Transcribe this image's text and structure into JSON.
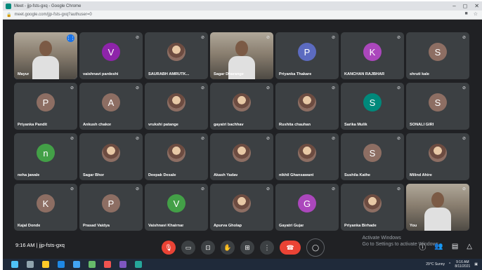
{
  "window": {
    "title": "Meet - jjp-fsts-gxq - Google Chrome",
    "url": "meet.google.com/jjp-fsts-gxq?authuser=0",
    "controls": [
      "–",
      "◻",
      "✕"
    ]
  },
  "participants": [
    {
      "name": "Mayur",
      "kind": "video",
      "speaking": true
    },
    {
      "name": "vaishnavi pardeshi",
      "kind": "initial",
      "initial": "V",
      "color": "#8e24aa"
    },
    {
      "name": "SAURABH AMRUTK...",
      "kind": "photo"
    },
    {
      "name": "Sagar Dharange",
      "kind": "video"
    },
    {
      "name": "Priyanka Thakare",
      "kind": "initial",
      "initial": "P",
      "color": "#5c6bc0"
    },
    {
      "name": "KANCHAN RAJBHAR",
      "kind": "initial",
      "initial": "K",
      "color": "#ab47bc"
    },
    {
      "name": "shruti kale",
      "kind": "initial",
      "initial": "S",
      "color": "#8d6e63"
    },
    {
      "name": "Priyanka Pandit",
      "kind": "initial",
      "initial": "P",
      "color": "#8d6e63"
    },
    {
      "name": "Ankush chakor",
      "kind": "initial",
      "initial": "A",
      "color": "#8d6e63"
    },
    {
      "name": "vrukshi patange",
      "kind": "photo"
    },
    {
      "name": "gayatri bachhav",
      "kind": "photo"
    },
    {
      "name": "Rushita chauhan",
      "kind": "photo"
    },
    {
      "name": "Sarika Mulik",
      "kind": "initial",
      "initial": "S",
      "color": "#00897b"
    },
    {
      "name": "SONALI GIRI",
      "kind": "initial",
      "initial": "S",
      "color": "#8d6e63"
    },
    {
      "name": "neha jawale",
      "kind": "initial",
      "initial": "n",
      "color": "#43a047"
    },
    {
      "name": "Sagar Bhor",
      "kind": "photo"
    },
    {
      "name": "Deepak Desale",
      "kind": "photo"
    },
    {
      "name": "Akash Yadav",
      "kind": "photo"
    },
    {
      "name": "nikhil Ghansawant",
      "kind": "photo"
    },
    {
      "name": "Sushila Kathe",
      "kind": "initial",
      "initial": "S",
      "color": "#8d6e63"
    },
    {
      "name": "Milind Ahire",
      "kind": "photo"
    },
    {
      "name": "Kajal Donde",
      "kind": "initial",
      "initial": "K",
      "color": "#8d6e63"
    },
    {
      "name": "Prasad Vaidya",
      "kind": "initial",
      "initial": "P",
      "color": "#8d6e63"
    },
    {
      "name": "Vaishnavi Khairnar",
      "kind": "initial",
      "initial": "V",
      "color": "#43a047"
    },
    {
      "name": "Apurva Gholap",
      "kind": "photo"
    },
    {
      "name": "Gayatri Gujar",
      "kind": "initial",
      "initial": "G",
      "color": "#ab47bc"
    },
    {
      "name": "Priyanka Birhade",
      "kind": "photo"
    },
    {
      "name": "You",
      "kind": "video"
    }
  ],
  "meeting": {
    "time": "9:16 AM",
    "separator": "|",
    "code": "jjp-fsts-gxq"
  },
  "watermark": {
    "line1": "Activate Windows",
    "line2": "Go to Settings to activate Windows."
  },
  "taskbar": {
    "weather": "29°C Sunny",
    "clock_time": "9:16 AM",
    "clock_date": "8/11/2021"
  }
}
